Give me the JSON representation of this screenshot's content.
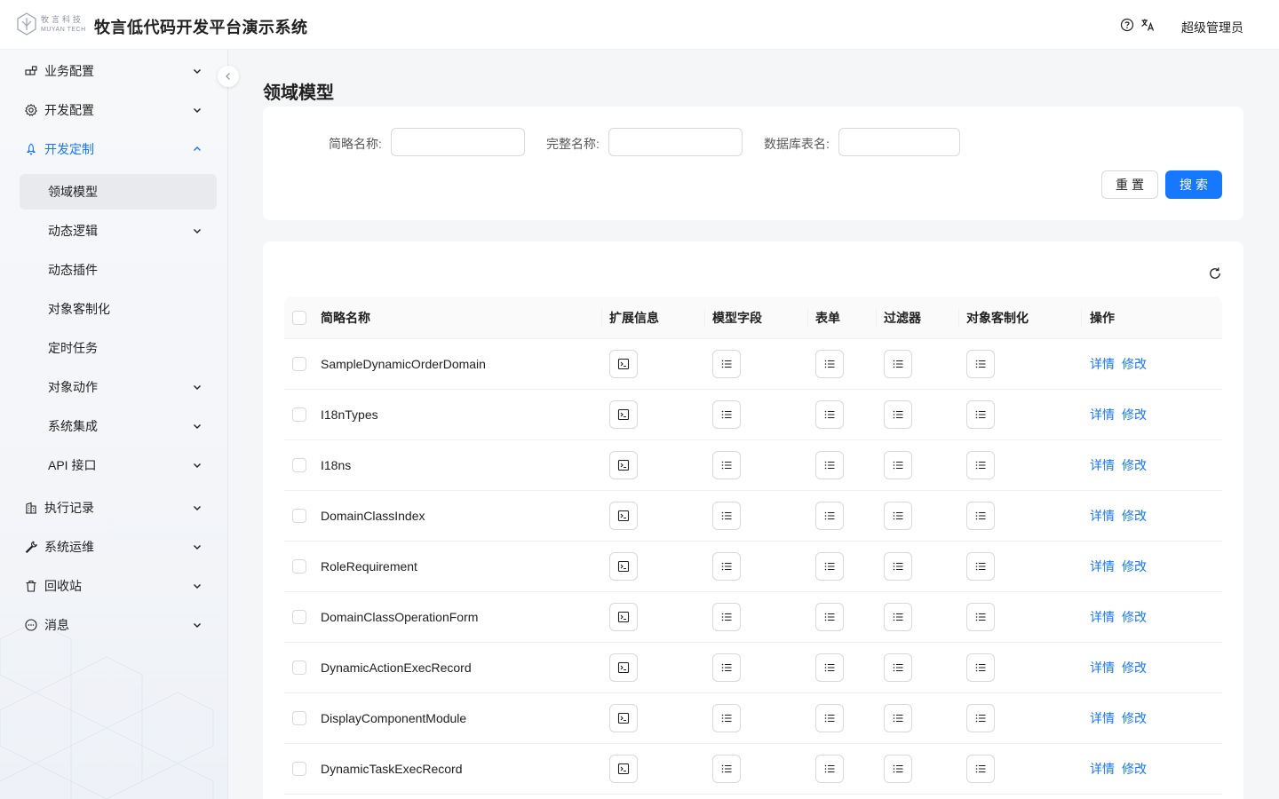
{
  "header": {
    "logo_cn": "牧言科技",
    "logo_en": "MUYAN TECH",
    "title": "牧言低代码开发平台演示系统",
    "user": "超级管理员"
  },
  "sidebar": {
    "items": [
      {
        "label": "业务配置",
        "icon": "apps-icon",
        "expanded": false
      },
      {
        "label": "开发配置",
        "icon": "gear-icon",
        "expanded": false
      },
      {
        "label": "开发定制",
        "icon": "rocket-icon",
        "expanded": true
      },
      {
        "label": "领域模型",
        "sub": true,
        "selected": true
      },
      {
        "label": "动态逻辑",
        "sub": true,
        "has_children": true
      },
      {
        "label": "动态插件",
        "sub": true
      },
      {
        "label": "对象客制化",
        "sub": true
      },
      {
        "label": "定时任务",
        "sub": true
      },
      {
        "label": "对象动作",
        "sub": true,
        "has_children": true
      },
      {
        "label": "系统集成",
        "sub": true,
        "has_children": true
      },
      {
        "label": "API 接口",
        "sub": true,
        "has_children": true
      },
      {
        "label": "执行记录",
        "icon": "building-icon",
        "expanded": false
      },
      {
        "label": "系统运维",
        "icon": "wrench-icon",
        "expanded": false
      },
      {
        "label": "回收站",
        "icon": "trash-icon",
        "expanded": false
      },
      {
        "label": "消息",
        "icon": "message-icon",
        "expanded": false
      }
    ]
  },
  "page": {
    "title": "领域模型"
  },
  "search": {
    "short_name_label": "简略名称",
    "full_name_label": "完整名称",
    "db_table_label": "数据库表名",
    "short_name_value": "",
    "full_name_value": "",
    "db_table_value": "",
    "reset_label": "重置",
    "search_label": "搜索"
  },
  "table": {
    "columns": [
      "简略名称",
      "扩展信息",
      "模型字段",
      "表单",
      "过滤器",
      "对象客制化",
      "操作"
    ],
    "detail_label": "详情",
    "edit_label": "修改",
    "rows": [
      {
        "name": "SampleDynamicOrderDomain"
      },
      {
        "name": "I18nTypes"
      },
      {
        "name": "I18ns"
      },
      {
        "name": "DomainClassIndex"
      },
      {
        "name": "RoleRequirement"
      },
      {
        "name": "DomainClassOperationForm"
      },
      {
        "name": "DynamicActionExecRecord"
      },
      {
        "name": "DisplayComponentModule"
      },
      {
        "name": "DynamicTaskExecRecord"
      }
    ]
  },
  "colors": {
    "primary": "#1677ff",
    "text": "#1f1f1f",
    "selected_bg": "#e8eaee"
  }
}
